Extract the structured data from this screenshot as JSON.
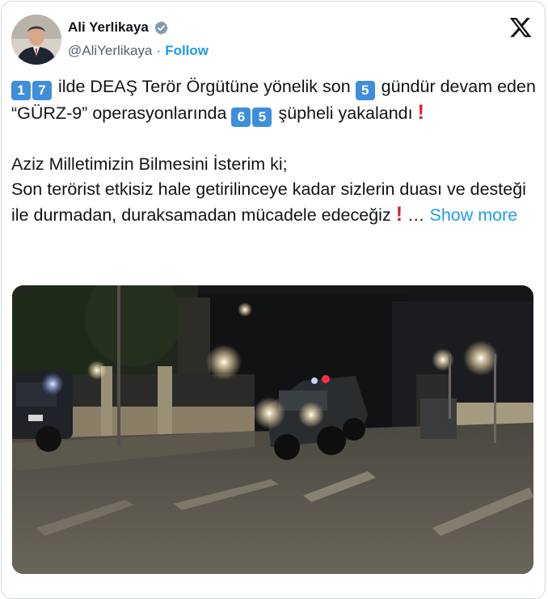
{
  "author": {
    "name": "Ali Yerlikaya",
    "handle": "@AliYerlikaya",
    "separator": "·",
    "follow_label": "Follow"
  },
  "tweet": {
    "line1": {
      "num_a1": "1",
      "num_a2": "7",
      "text_a": "ilde DEAŞ Terör Örgütüne yönelik son",
      "num_b": "5",
      "text_b": "gündür devam eden “GÜRZ-9” operasyonlarında",
      "num_c1": "6",
      "num_c2": "5",
      "text_c": "şüpheli yakalandı",
      "mark": "!"
    },
    "line2": "Aziz Milletimizin Bilmesini İsterim ki;",
    "line3": "Son terörist etkisiz hale getirilinceye kadar sizlerin duası ve desteği ile durmadan, duraksamadan mücadele edeceğiz",
    "line3_mark": "!",
    "ellipsis": "…",
    "show_more": "Show more"
  },
  "icons": {
    "verified": "verified-badge-icon",
    "platform": "x-logo-icon",
    "keycap_color": "#3d8edb",
    "exclamation_color": "#d71f2b",
    "link_color": "#1d9bf0"
  }
}
